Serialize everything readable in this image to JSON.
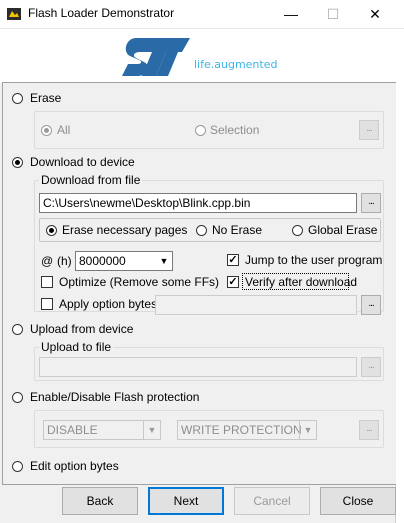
{
  "window": {
    "title": "Flash Loader Demonstrator",
    "minimize": "—",
    "maximize": "☐",
    "close": "✕"
  },
  "banner": {
    "tagline": "life.augmented",
    "brand_color": "#2a6ba7"
  },
  "erase": {
    "label": "Erase",
    "selected": false,
    "all_label": "All",
    "selection_label": "Selection",
    "browse": "..."
  },
  "download": {
    "label": "Download to device",
    "selected": true,
    "group_title": "Download from file",
    "file_path": "C:\\Users\\newme\\Desktop\\Blink.cpp.bin",
    "browse": "...",
    "erase_necessary": "Erase necessary pages",
    "no_erase": "No Erase",
    "global_erase": "Global Erase",
    "at": "@",
    "h": "(h)",
    "address": "8000000",
    "jump_label": "Jump to the user program",
    "jump_checked": true,
    "optimize_label": "Optimize (Remove some FFs)",
    "optimize_checked": false,
    "verify_label": "Verify after download",
    "verify_checked": true,
    "apply_option_label": "Apply option bytes",
    "apply_option_checked": false,
    "apply_browse": "..."
  },
  "upload": {
    "label": "Upload from device",
    "selected": false,
    "group_title": "Upload to file",
    "browse": "..."
  },
  "protection": {
    "label": "Enable/Disable Flash protection",
    "selected": false,
    "mode": "DISABLE",
    "type": "WRITE PROTECTION",
    "browse": "..."
  },
  "edit_option": {
    "label": "Edit option bytes",
    "selected": false
  },
  "buttons": {
    "back": "Back",
    "next": "Next",
    "cancel": "Cancel",
    "close": "Close"
  }
}
